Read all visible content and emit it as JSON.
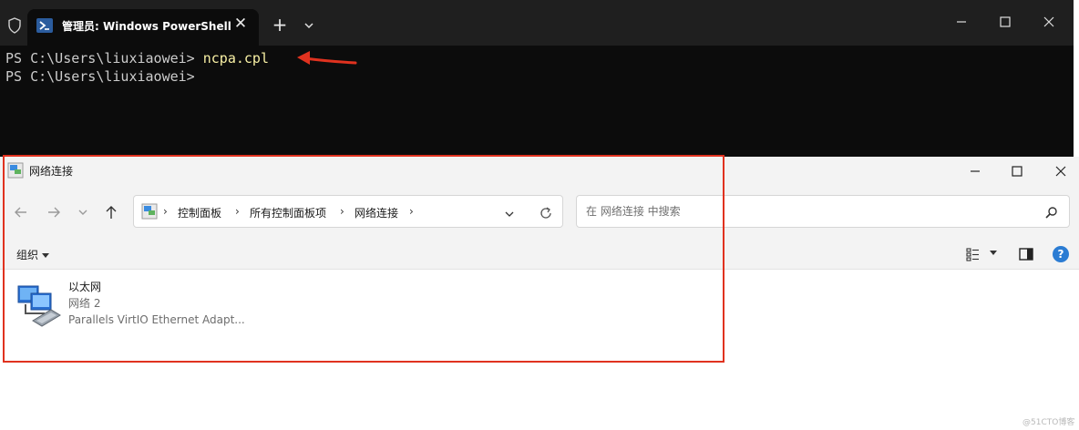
{
  "terminal": {
    "tab_title": "管理员: Windows PowerShell",
    "tab_close": "✕",
    "new_tab": "+",
    "lines": [
      {
        "prompt": "PS C:\\Users\\liuxiaowei> ",
        "command": "ncpa.cpl"
      },
      {
        "prompt": "PS C:\\Users\\liuxiaowei>",
        "command": ""
      }
    ]
  },
  "explorer": {
    "title": "网络连接",
    "breadcrumb": [
      "控制面板",
      "所有控制面板项",
      "网络连接"
    ],
    "search_placeholder": "在 网络连接 中搜索",
    "organize_label": "组织",
    "help": "?",
    "item": {
      "name": "以太网",
      "network": "网络 2",
      "adapter": "Parallels VirtIO Ethernet Adapt..."
    }
  },
  "watermark": "@51CTO博客",
  "colors": {
    "annotation": "#e0321f",
    "terminal_bg": "#0c0c0c",
    "command_text": "#f9f1a5",
    "accent": "#2b7cd3"
  }
}
